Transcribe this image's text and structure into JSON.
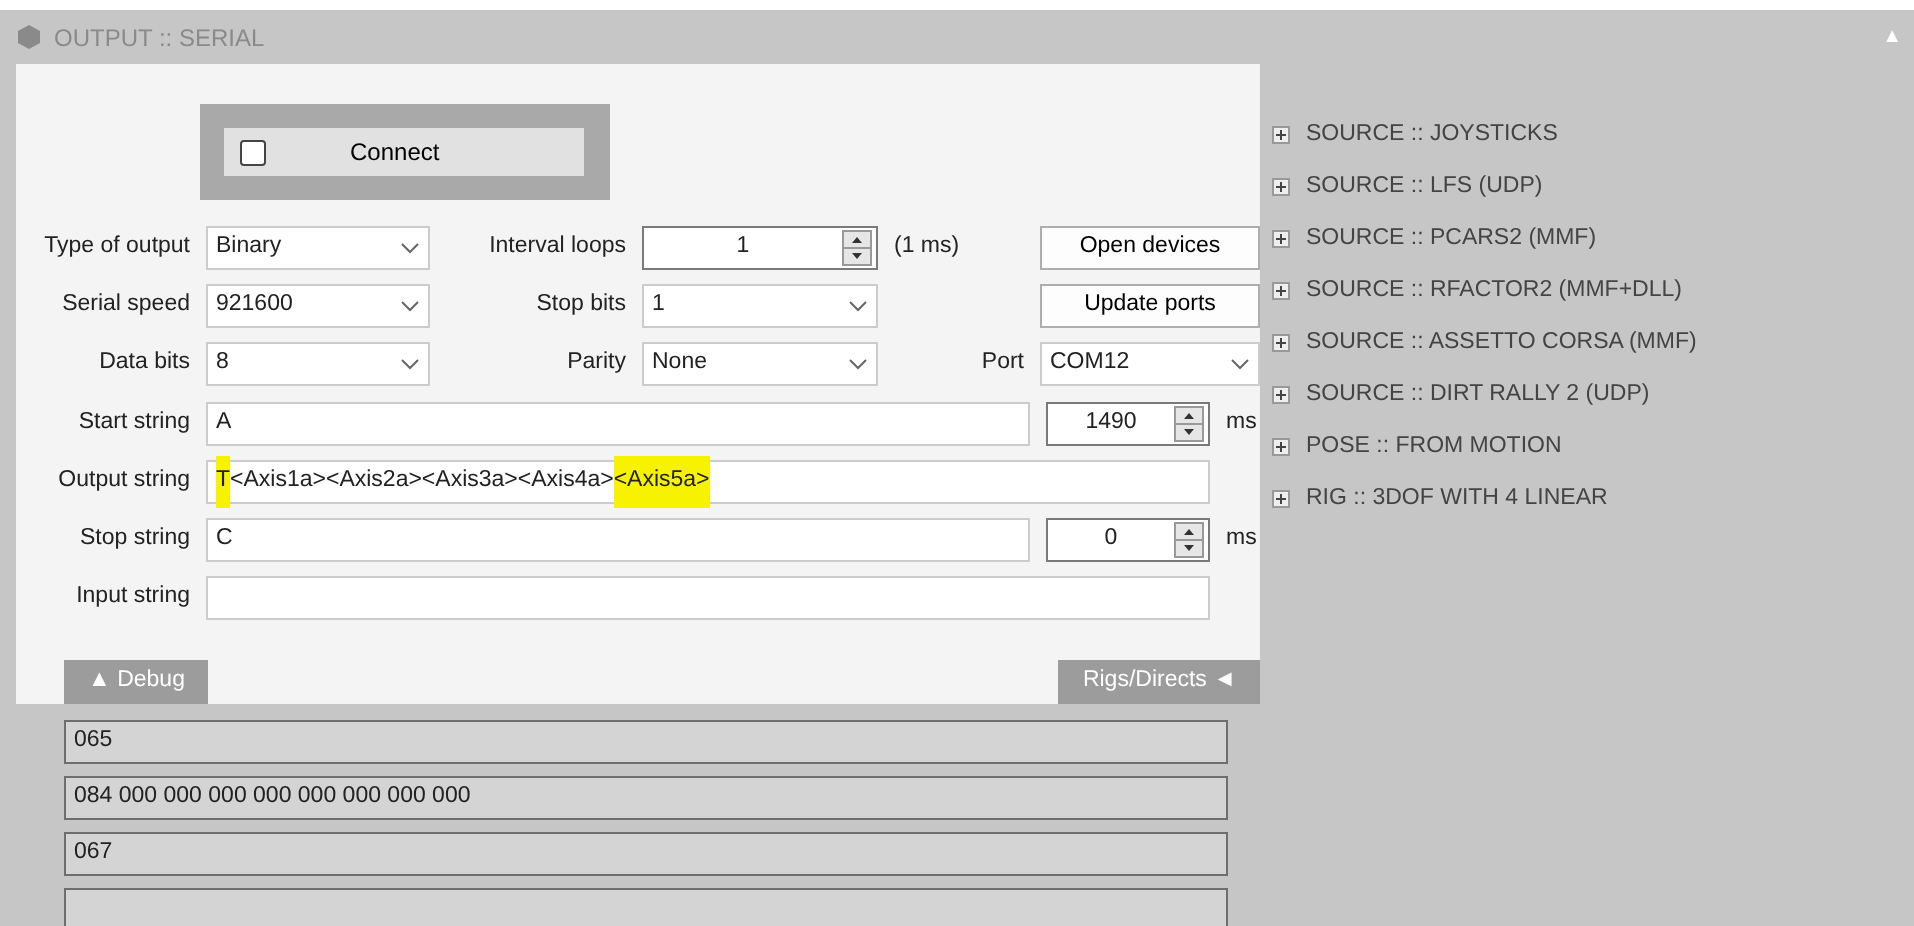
{
  "window": {
    "title": "OUTPUT :: SERIAL",
    "collapse_glyph": "▲"
  },
  "connect": {
    "label": "Connect",
    "checked": false
  },
  "settings": [
    {
      "label": "Type of output",
      "kind": "combo",
      "value": "Binary"
    },
    {
      "label": "Interval loops",
      "kind": "spin",
      "value": "1",
      "suffix": "(1 ms)"
    },
    {
      "label": "Open devices",
      "kind": "button"
    },
    {
      "label": "Serial speed",
      "kind": "combo",
      "value": "921600"
    },
    {
      "label": "Stop bits",
      "kind": "combo",
      "value": "1"
    },
    {
      "label": "Update ports",
      "kind": "button"
    },
    {
      "label": "Data bits",
      "kind": "combo",
      "value": "8"
    },
    {
      "label": "Parity",
      "kind": "combo",
      "value": "None"
    },
    {
      "label": "Port",
      "kind": "combo",
      "value": "COM12"
    }
  ],
  "strings": [
    {
      "label": "Start string",
      "value": [
        {
          "text": "A",
          "highlighted": false
        }
      ],
      "delay": "1490",
      "unit": "ms"
    },
    {
      "label": "Output string",
      "value": [
        {
          "text": "T",
          "highlighted": true
        },
        {
          "text": "<Axis1a><Axis2a><Axis3a><Axis4a>",
          "highlighted": false
        },
        {
          "text": "<Axis5a>",
          "highlighted": true
        }
      ]
    },
    {
      "label": "Stop string",
      "value": [
        {
          "text": "C",
          "highlighted": false
        }
      ],
      "delay": "0",
      "unit": "ms"
    },
    {
      "label": "Input string"
    }
  ],
  "tabs": [
    {
      "label": "▲ Debug"
    },
    {
      "label": "Rigs/Directs ◄"
    }
  ],
  "debug_lines": [
    {
      "kind": "text",
      "text": "065"
    },
    {
      "kind": "text",
      "text": "084 000 000 000 000 000 000 000 000"
    },
    {
      "kind": "text",
      "text": "067"
    },
    {
      "kind": "blank"
    }
  ],
  "tree": [
    {
      "label": "SOURCE :: JOYSTICKS",
      "expanded": false
    },
    {
      "label": "SOURCE :: LFS (UDP)",
      "expanded": false
    },
    {
      "label": "SOURCE :: PCARS2 (MMF)",
      "expanded": false
    },
    {
      "label": "SOURCE :: RFACTOR2 (MMF+DLL)",
      "expanded": false
    },
    {
      "label": "SOURCE :: ASSETTO CORSA (MMF)",
      "expanded": false
    },
    {
      "label": "SOURCE :: DIRT RALLY 2 (UDP)",
      "expanded": false
    },
    {
      "label": "POSE :: FROM MOTION",
      "expanded": false
    },
    {
      "label": "RIG :: 3DOF WITH 4 LINEAR",
      "expanded": false
    }
  ]
}
